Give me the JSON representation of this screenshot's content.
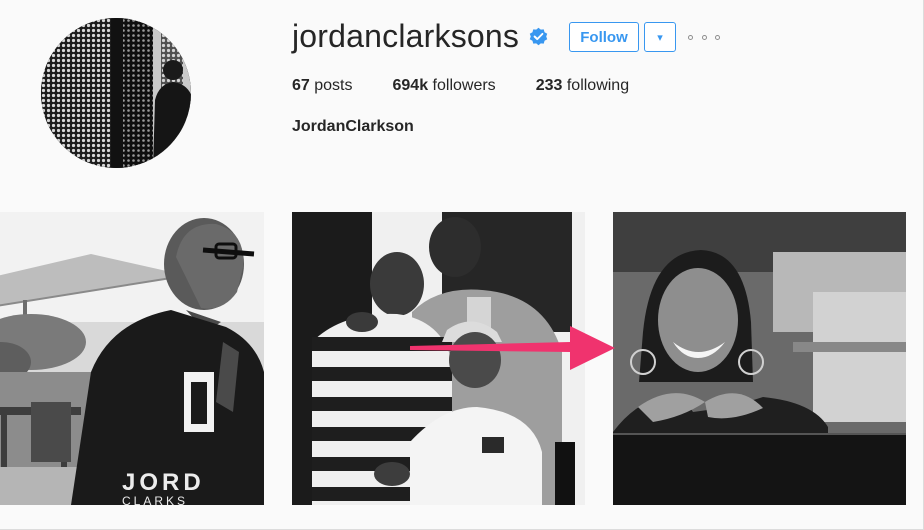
{
  "profile": {
    "username": "jordanclarksons",
    "verified": true,
    "follow_label": "Follow",
    "dropdown_glyph": "▾",
    "more_icon": "more-options-icon",
    "full_name": "JordanClarkson"
  },
  "stats": {
    "posts_count": "67",
    "posts_label": "posts",
    "followers_count": "694k",
    "followers_label": "followers",
    "following_count": "233",
    "following_label": "following"
  },
  "colors": {
    "accent": "#3897f0",
    "annotation_arrow": "#f0336e",
    "text": "#262626",
    "background": "#fafafa"
  },
  "posts": [
    {
      "id": "post-1",
      "jersey_text_1": "JORD",
      "jersey_text_2": "CLARKS"
    },
    {
      "id": "post-2"
    },
    {
      "id": "post-3"
    }
  ]
}
